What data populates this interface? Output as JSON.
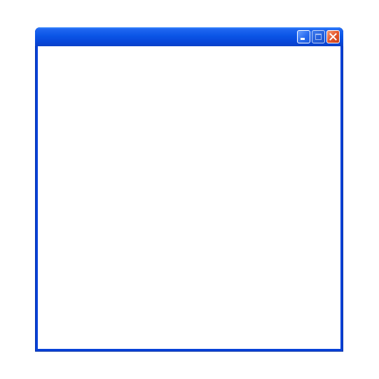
{
  "window": {
    "title": "",
    "colors": {
      "frame": "#0842d8",
      "titlebar": "#0b55e6",
      "close_button": "#e5572c",
      "client": "#ffffff"
    }
  },
  "caption_buttons": {
    "minimize_icon": "minimize-icon",
    "maximize_icon": "maximize-icon",
    "close_icon": "close-icon"
  }
}
